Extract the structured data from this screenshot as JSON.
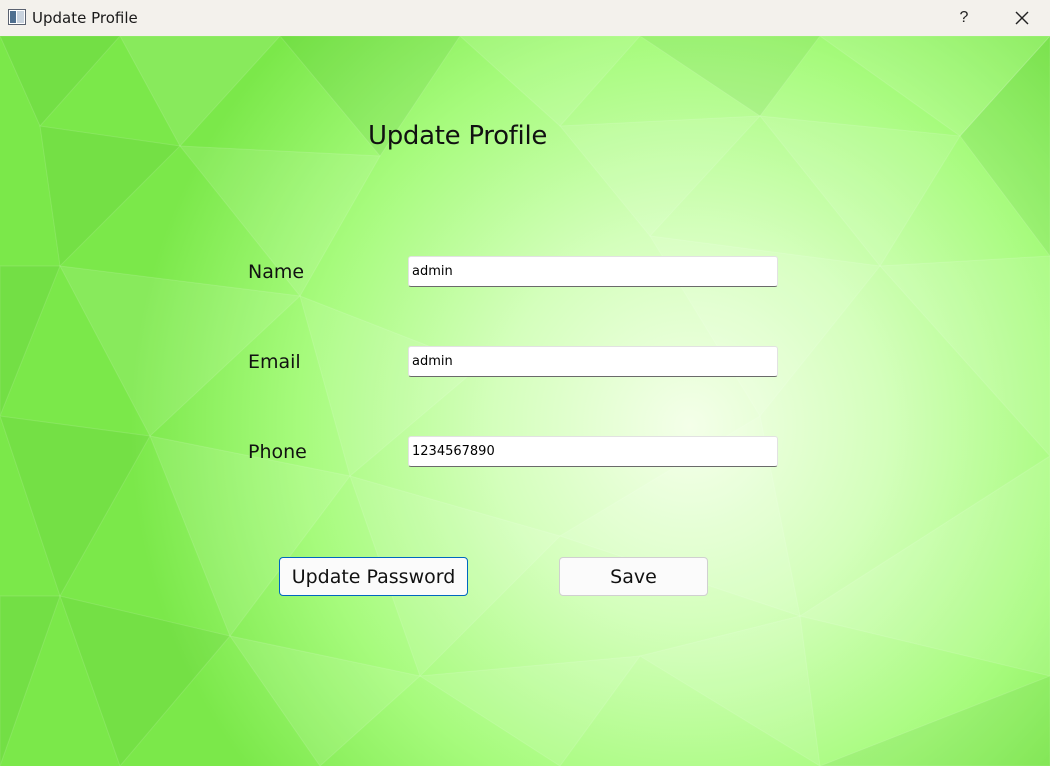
{
  "window": {
    "title": "Update Profile",
    "help_label": "?",
    "close_icon": "close-icon"
  },
  "form": {
    "heading": "Update Profile",
    "fields": [
      {
        "label": "Name",
        "value": "admin"
      },
      {
        "label": "Email",
        "value": "admin"
      },
      {
        "label": "Phone",
        "value": "1234567890"
      }
    ]
  },
  "buttons": {
    "update_password": "Update Password",
    "save": "Save"
  },
  "colors": {
    "background_green": "#8ef25c",
    "focus_border": "#0067c0",
    "titlebar": "#f3f1ec"
  }
}
